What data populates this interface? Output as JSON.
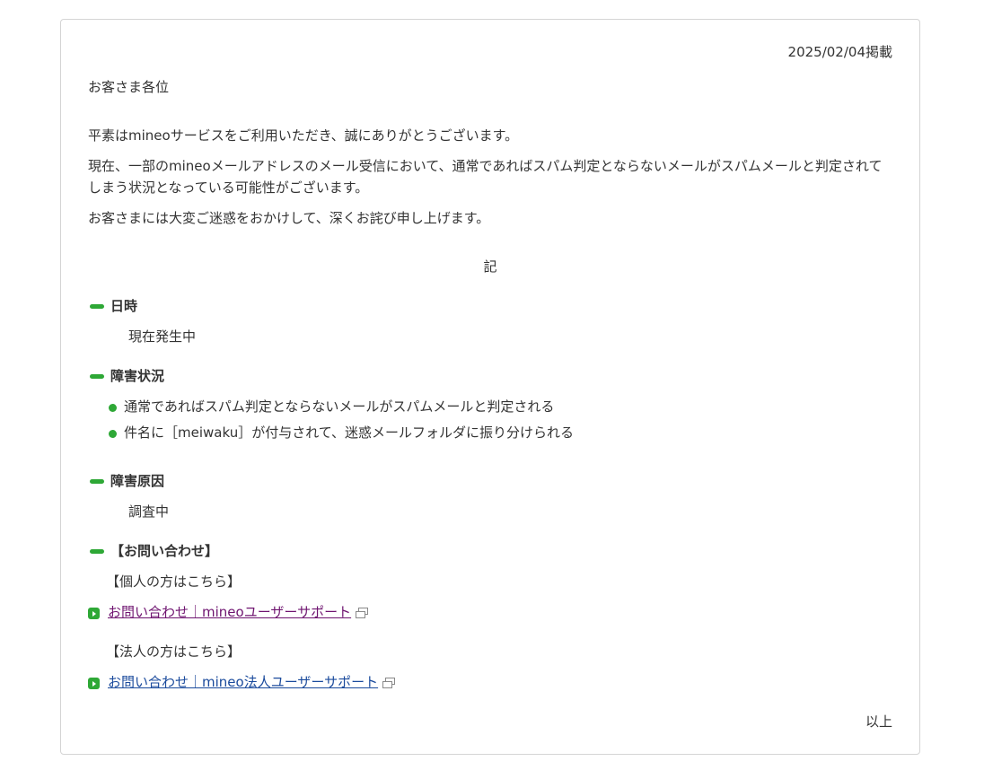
{
  "notice": {
    "date": "2025/02/04掲載",
    "greeting": "お客さま各位",
    "paragraphs": [
      "平素はmineoサービスをご利用いただき、誠にありがとうございます。",
      "現在、一部のmineoメールアドレスのメール受信において、通常であればスパム判定とならないメールがスパムメールと判定されて",
      "しまう状況となっている可能性がございます。",
      "お客さまには大変ご迷惑をおかけして、深くお詫び申し上げます。"
    ],
    "ki": "記",
    "sections": {
      "datetime": {
        "heading": "日時",
        "body": "現在発生中"
      },
      "status": {
        "heading": "障害状況",
        "items": [
          "通常であればスパム判定とならないメールがスパムメールと判定される",
          "件名に［meiwaku］が付与されて、迷惑メールフォルダに振り分けられる"
        ]
      },
      "cause": {
        "heading": "障害原因",
        "body": "調査中"
      },
      "contact": {
        "heading": "【お問い合わせ】",
        "personal_label": "【個人の方はこちら】",
        "personal_link": "お問い合わせ｜mineoユーザーサポート",
        "corporate_label": "【法人の方はこちら】",
        "corporate_link": "お問い合わせ｜mineo法人ユーザーサポート"
      }
    },
    "closing": "以上"
  },
  "colors": {
    "accent": "#2ea836",
    "visited_link": "#6e136f",
    "link": "#1a4a9c"
  },
  "icons": [
    "green-bar-icon",
    "green-dot-icon",
    "green-arrow-icon",
    "external-window-icon"
  ]
}
